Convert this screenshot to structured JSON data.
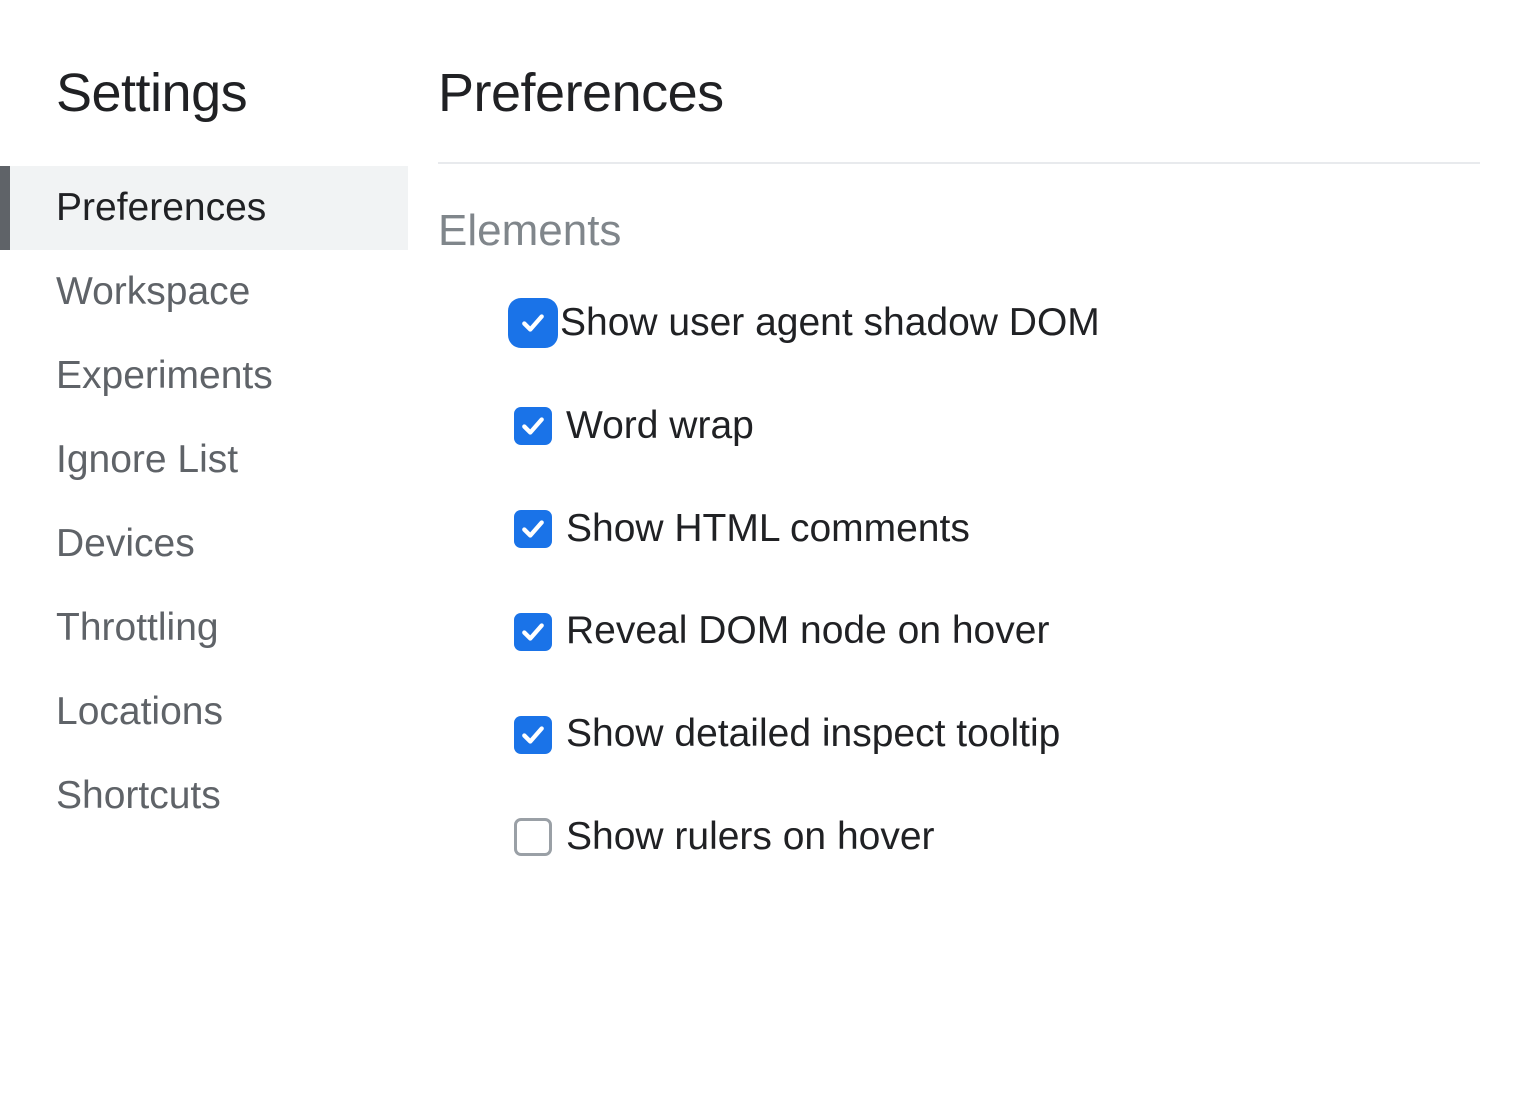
{
  "sidebar": {
    "title": "Settings",
    "items": [
      {
        "label": "Preferences",
        "active": true
      },
      {
        "label": "Workspace",
        "active": false
      },
      {
        "label": "Experiments",
        "active": false
      },
      {
        "label": "Ignore List",
        "active": false
      },
      {
        "label": "Devices",
        "active": false
      },
      {
        "label": "Throttling",
        "active": false
      },
      {
        "label": "Locations",
        "active": false
      },
      {
        "label": "Shortcuts",
        "active": false
      }
    ]
  },
  "main": {
    "title": "Preferences",
    "section_header": "Elements",
    "options": [
      {
        "label": "Show user agent shadow DOM",
        "checked": true,
        "focused": true
      },
      {
        "label": "Word wrap",
        "checked": true,
        "focused": false
      },
      {
        "label": "Show HTML comments",
        "checked": true,
        "focused": false
      },
      {
        "label": "Reveal DOM node on hover",
        "checked": true,
        "focused": false
      },
      {
        "label": "Show detailed inspect tooltip",
        "checked": true,
        "focused": false
      },
      {
        "label": "Show rulers on hover",
        "checked": false,
        "focused": false
      }
    ]
  }
}
